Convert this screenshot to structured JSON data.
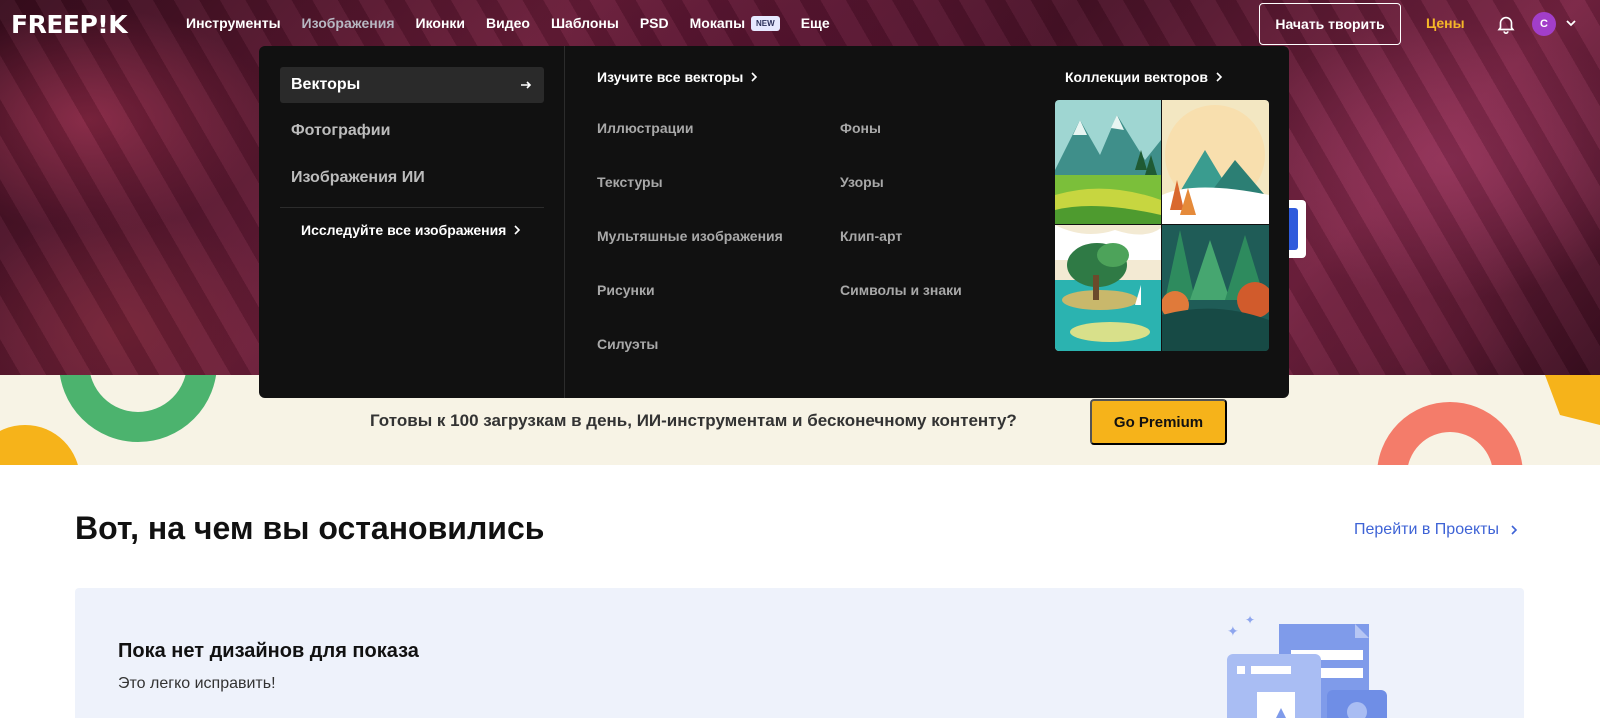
{
  "brand": {
    "logo": "FREEP!K"
  },
  "nav": {
    "items": [
      {
        "label": "Инструменты",
        "active": false
      },
      {
        "label": "Изображения",
        "active": true
      },
      {
        "label": "Иконки",
        "active": false
      },
      {
        "label": "Видео",
        "active": false
      },
      {
        "label": "Шаблоны",
        "active": false
      },
      {
        "label": "PSD",
        "active": false
      },
      {
        "label": "Мокапы",
        "active": false,
        "badge": "NEW"
      },
      {
        "label": "Еще",
        "active": false
      }
    ],
    "start_label": "Начать творить",
    "prices_label": "Цены",
    "avatar_initial": "C"
  },
  "mega_menu": {
    "categories": [
      {
        "label": "Векторы",
        "active": true
      },
      {
        "label": "Фотографии",
        "active": false
      },
      {
        "label": "Изображения ИИ",
        "active": false
      }
    ],
    "explore_all": "Исследуйте все изображения",
    "study_all": "Изучите все векторы",
    "subcategories_col1": [
      "Иллюстрации",
      "Текстуры",
      "Мультяшные изображения",
      "Рисунки",
      "Силуэты"
    ],
    "subcategories_col2": [
      "Фоны",
      "Узоры",
      "Клип-арт",
      "Символы и знаки"
    ],
    "collections_label": "Коллекции векторов"
  },
  "banner": {
    "text": "Готовы к 100 загрузкам в день, ИИ-инструментам и бесконечному контенту?",
    "button": "Go Premium"
  },
  "continue_section": {
    "title": "Вот, на чем вы остановились",
    "projects_link": "Перейти в Проекты",
    "empty_title": "Пока нет дизайнов для показа",
    "empty_subtitle": "Это легко исправить!"
  },
  "colors": {
    "accent_premium": "#f6b31a",
    "prices": "#f5b728",
    "link_blue": "#3e63d6",
    "avatar": "#a23ec9",
    "menu_bg": "#111111"
  }
}
